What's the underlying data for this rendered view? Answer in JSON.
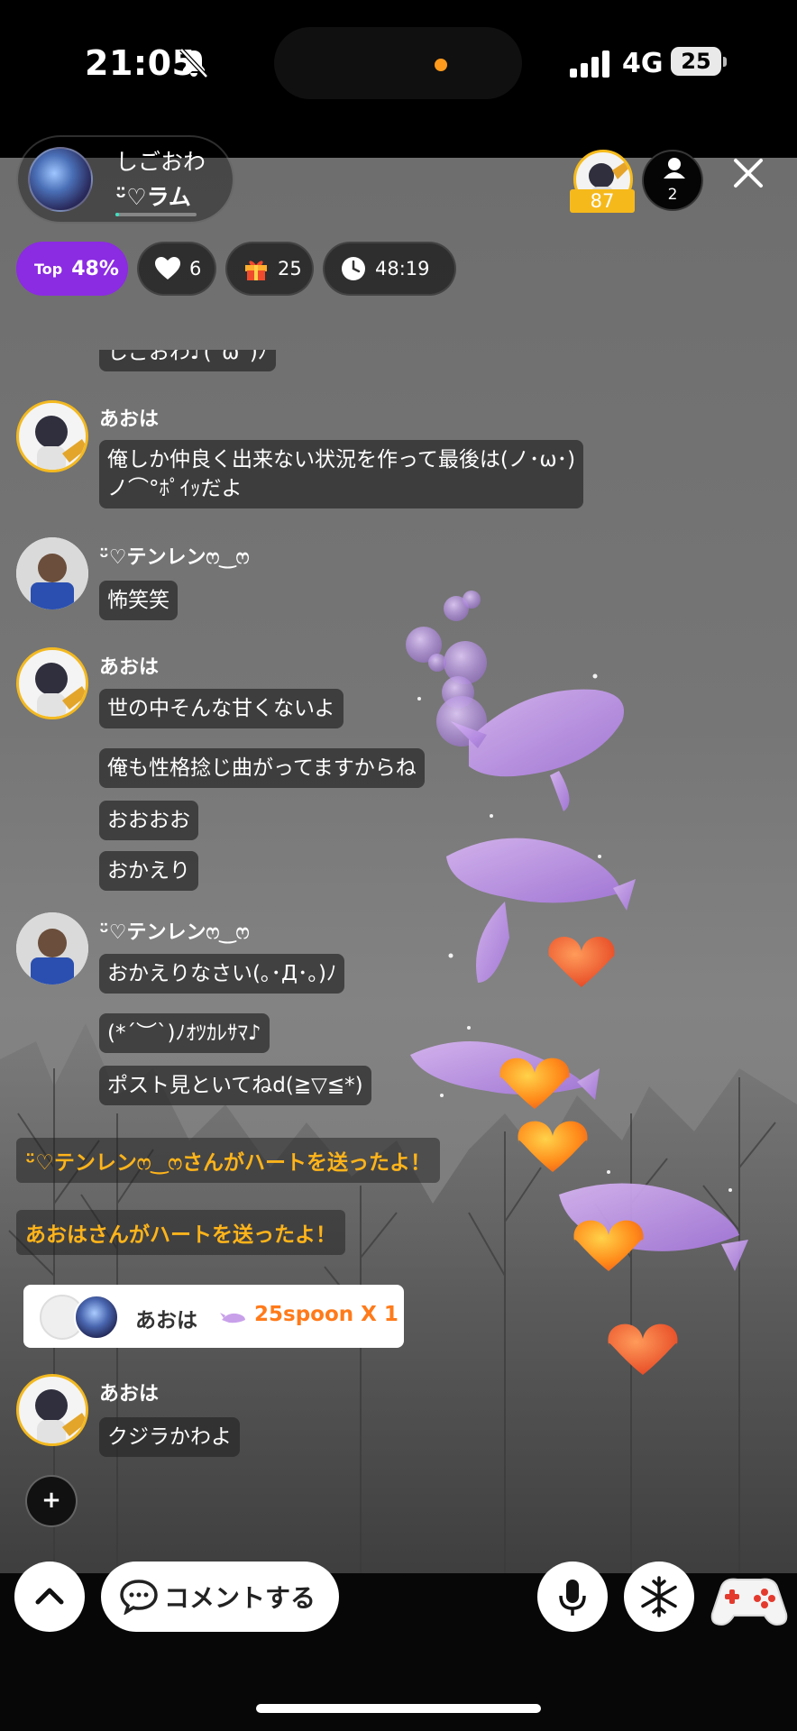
{
  "status_bar": {
    "time": "21:05",
    "network": "4G",
    "battery": "25",
    "icons": [
      "bell-slash-icon",
      "signal-icon",
      "battery-icon"
    ]
  },
  "host": {
    "name": "しごおわ",
    "subtitle": "ᵕ̈♡ラム"
  },
  "top_fan": {
    "badge": "87"
  },
  "listeners": {
    "count": "2"
  },
  "stats": {
    "top_label": "Top",
    "top_value": "48%",
    "likes": "6",
    "gifts": "25",
    "elapsed": "48:19"
  },
  "chat": {
    "partial_text": "しごおわ♪(´ω`)ﾉ",
    "messages": [
      {
        "user": "あおは",
        "lines": [
          "俺しか仲良く出来ない状況を作って最後は(ノ･ω･)",
          "ノ⌒°ﾎﾟｲｯだよ"
        ]
      },
      {
        "user": "ᵕ̈♡テンレンෆ‿ෆ",
        "lines": [
          "怖笑笑"
        ]
      },
      {
        "user": "あおは",
        "lines": [
          "世の中そんな甘くないよ",
          "俺も性格捻じ曲がってますからね",
          "おおおお",
          "おかえり"
        ]
      },
      {
        "user": "ᵕ̈♡テンレンෆ‿ෆ",
        "lines": [
          "おかえりなさい(｡･Д･｡)ﾉ",
          "(*´︶`)ﾉｵﾂｶﾚｻﾏ♪",
          "ポスト見といてねd(≧▽≦*)"
        ]
      },
      {
        "user": "あおは",
        "lines": [
          "クジラかわよ"
        ]
      }
    ],
    "notices": [
      "ᵕ̈♡テンレンෆ‿ෆさんがハートを送ったよ！",
      "あおはさんがハートを送ったよ！"
    ],
    "spoon_gift": {
      "user": "あおは",
      "amount": "25spoon X 1"
    }
  },
  "bottom": {
    "comment_label": "コメントする",
    "icons": [
      "chevron-up-icon",
      "speech-bubble-icon",
      "mic-icon",
      "snowflake-icon",
      "gamepad-icon"
    ]
  },
  "colors": {
    "accent_purple": "#8b2be2",
    "notice_orange": "#ffb41a",
    "spoon_orange": "#ff7a1a",
    "fan_gold": "#f6b91c"
  }
}
